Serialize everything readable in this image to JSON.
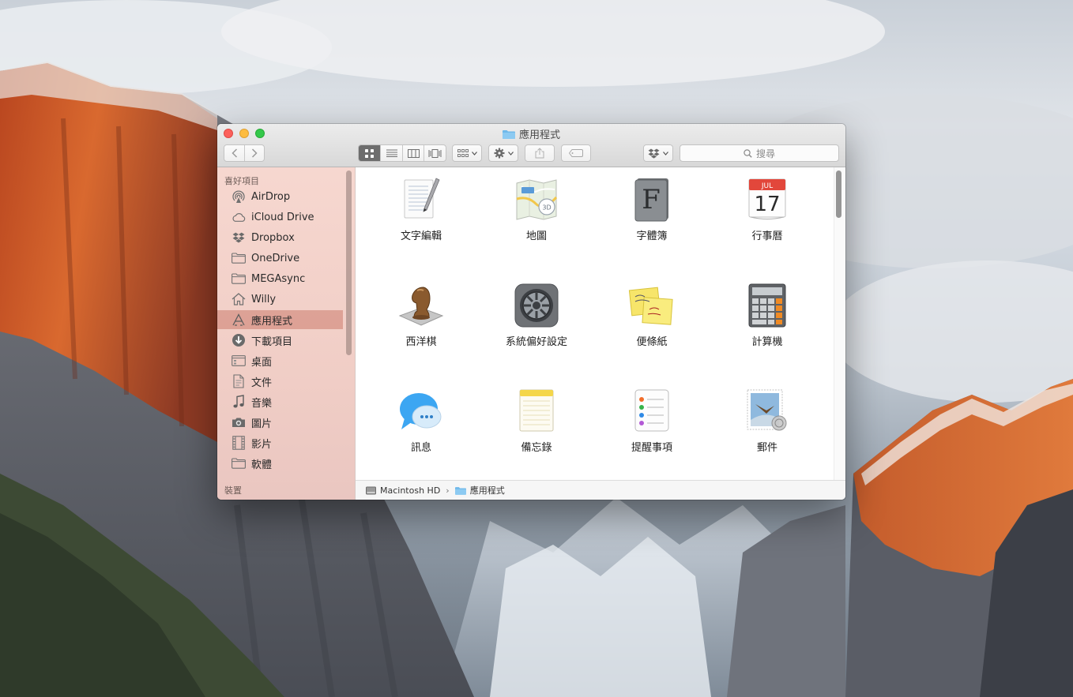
{
  "window": {
    "title": "應用程式"
  },
  "toolbar": {
    "search_placeholder": "搜尋"
  },
  "sidebar": {
    "favorites_header": "喜好項目",
    "devices_header": "裝置",
    "items": [
      {
        "label": "AirDrop",
        "icon": "airdrop-icon"
      },
      {
        "label": "iCloud Drive",
        "icon": "cloud-icon"
      },
      {
        "label": "Dropbox",
        "icon": "dropbox-icon"
      },
      {
        "label": "OneDrive",
        "icon": "folder-icon"
      },
      {
        "label": "MEGAsync",
        "icon": "folder-icon"
      },
      {
        "label": "Willy",
        "icon": "home-icon"
      },
      {
        "label": "應用程式",
        "icon": "applications-icon"
      },
      {
        "label": "下載項目",
        "icon": "download-icon"
      },
      {
        "label": "桌面",
        "icon": "desktop-icon"
      },
      {
        "label": "文件",
        "icon": "document-icon"
      },
      {
        "label": "音樂",
        "icon": "music-icon"
      },
      {
        "label": "圖片",
        "icon": "camera-icon"
      },
      {
        "label": "影片",
        "icon": "film-icon"
      },
      {
        "label": "軟體",
        "icon": "folder-icon"
      }
    ],
    "selected_index": 6
  },
  "apps": [
    {
      "label": "文字編輯",
      "icon": "textedit-icon"
    },
    {
      "label": "地圖",
      "icon": "maps-icon"
    },
    {
      "label": "字體簿",
      "icon": "fontbook-icon"
    },
    {
      "label": "行事曆",
      "icon": "calendar-icon"
    },
    {
      "label": "西洋棋",
      "icon": "chess-icon"
    },
    {
      "label": "系統偏好設定",
      "icon": "system-preferences-icon"
    },
    {
      "label": "便條紙",
      "icon": "stickies-icon"
    },
    {
      "label": "計算機",
      "icon": "calculator-icon"
    },
    {
      "label": "訊息",
      "icon": "messages-icon"
    },
    {
      "label": "備忘錄",
      "icon": "notes-icon"
    },
    {
      "label": "提醒事項",
      "icon": "reminders-icon"
    },
    {
      "label": "郵件",
      "icon": "mail-icon"
    }
  ],
  "icon_text": {
    "calendar_month": "JUL",
    "calendar_day": "17",
    "fontbook_letter": "F",
    "maps_3d": "3D"
  },
  "pathbar": {
    "disk": "Macintosh HD",
    "folder": "應用程式"
  },
  "colors": {
    "selection": "#d69284",
    "sidebar_bg": "#f6d6ce",
    "close": "#fc605b",
    "minimize": "#fdbc40",
    "maximize": "#34c84a"
  }
}
